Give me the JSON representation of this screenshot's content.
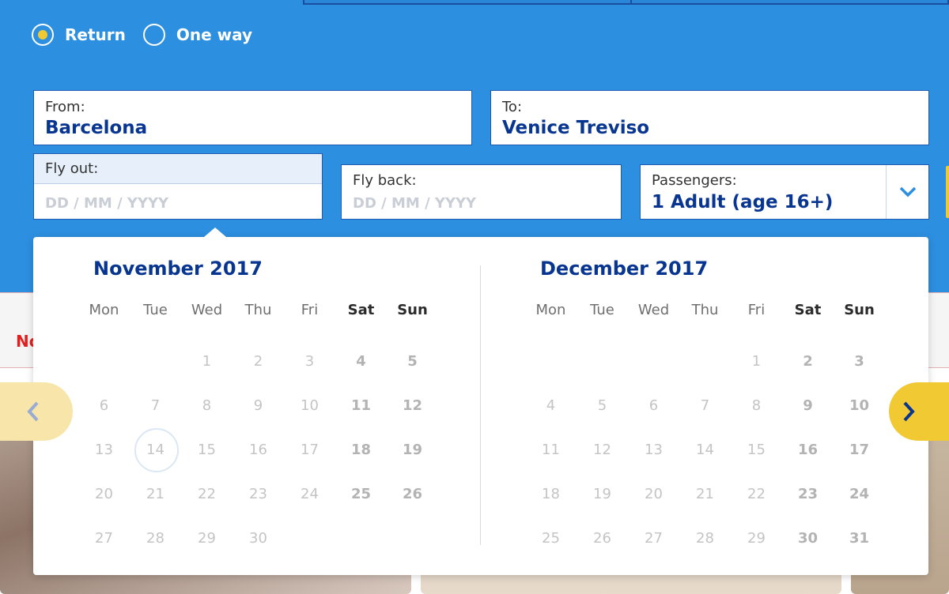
{
  "trip_type": {
    "options": [
      {
        "label": "Return",
        "checked": true
      },
      {
        "label": "One way",
        "checked": false
      }
    ]
  },
  "from": {
    "label": "From:",
    "value": "Barcelona"
  },
  "to": {
    "label": "To:",
    "value": "Venice Treviso"
  },
  "fly_out": {
    "label": "Fly out:",
    "placeholder": "DD / MM / YYYY"
  },
  "fly_back": {
    "label": "Fly back:",
    "placeholder": "DD / MM / YYYY"
  },
  "passengers": {
    "label": "Passengers:",
    "value": "1 Adult (age 16+)",
    "icon": "chevron-down-icon"
  },
  "promo": {
    "text": "No"
  },
  "calendar": {
    "weekdays": [
      "Mon",
      "Tue",
      "Wed",
      "Thu",
      "Fri",
      "Sat",
      "Sun"
    ],
    "today": "14",
    "months": [
      {
        "title": "November 2017",
        "lead_blanks": 2,
        "days": [
          "1",
          "2",
          "3",
          "4",
          "5",
          "6",
          "7",
          "8",
          "9",
          "10",
          "11",
          "12",
          "13",
          "14",
          "15",
          "16",
          "17",
          "18",
          "19",
          "20",
          "21",
          "22",
          "23",
          "24",
          "25",
          "26",
          "27",
          "28",
          "29",
          "30"
        ]
      },
      {
        "title": "December 2017",
        "lead_blanks": 4,
        "days": [
          "1",
          "2",
          "3",
          "4",
          "5",
          "6",
          "7",
          "8",
          "9",
          "10",
          "11",
          "12",
          "13",
          "14",
          "15",
          "16",
          "17",
          "18",
          "19",
          "20",
          "21",
          "22",
          "23",
          "24",
          "25",
          "26",
          "27",
          "28",
          "29",
          "30",
          "31"
        ]
      }
    ],
    "prev_icon": "chevron-left-icon",
    "next_icon": "chevron-right-icon"
  },
  "colors": {
    "band": "#2d8fe0",
    "navy": "#073590",
    "yellow": "#f1c933"
  }
}
